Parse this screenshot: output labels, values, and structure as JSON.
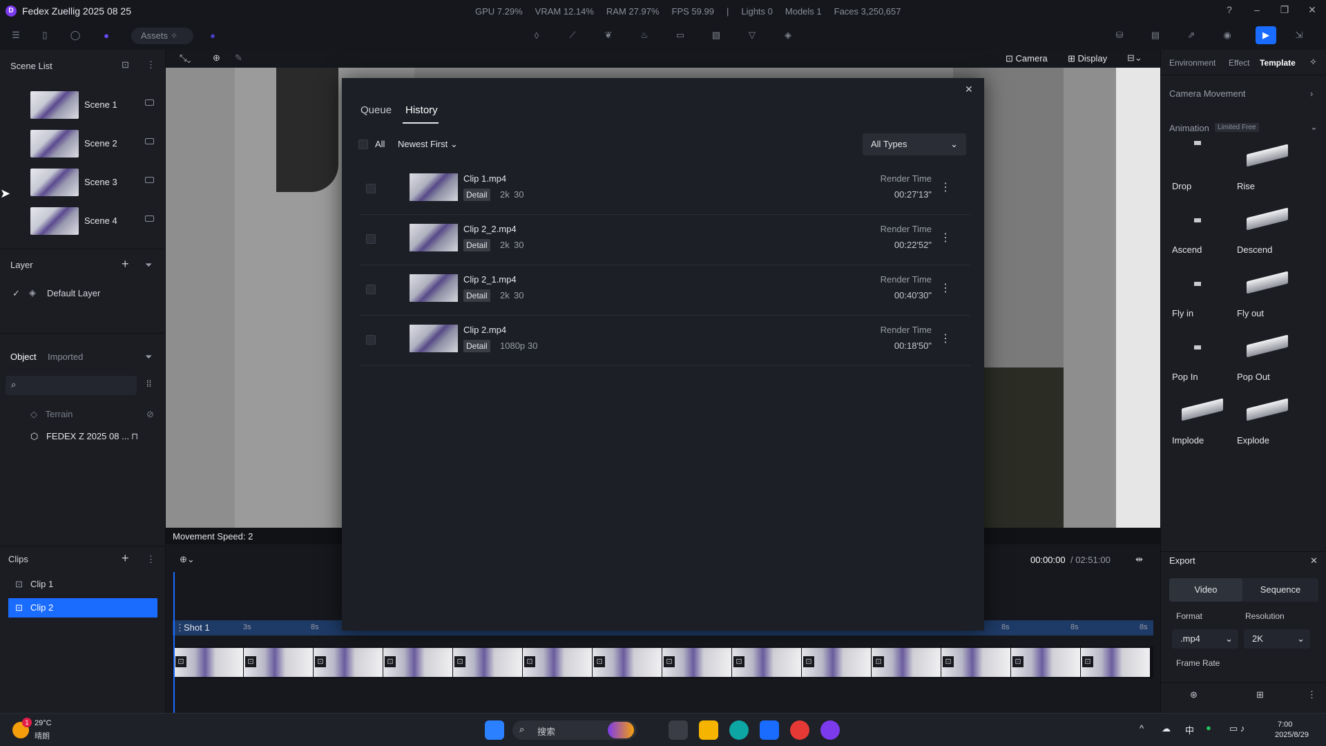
{
  "window": {
    "title": "Fedex Zuellig 2025 08 25",
    "stats": [
      "GPU 7.29%",
      "VRAM 12.14%",
      "RAM 27.97%",
      "FPS 59.99",
      "|",
      "Lights 0",
      "Models 1",
      "Faces 3,250,657"
    ]
  },
  "toolbar": {
    "assets_label": "Assets"
  },
  "left": {
    "scene_list_title": "Scene List",
    "scenes": [
      "Scene 1",
      "Scene 2",
      "Scene 3",
      "Scene 4"
    ],
    "layer_title": "Layer",
    "default_layer": "Default Layer",
    "tabs": [
      "Object",
      "Imported"
    ],
    "objects": [
      "Terrain",
      "FEDEX Z 2025 08 ..."
    ],
    "clips_title": "Clips",
    "clips": [
      "Clip 1",
      "Clip 2"
    ]
  },
  "viewport": {
    "camera_label": "Camera",
    "display_label": "Display",
    "movement_speed": "Movement Speed: 2"
  },
  "timeline": {
    "current_time": "00:00:00",
    "total_time": "/ 02:51:00",
    "shot_label": "Shot 1",
    "tick_labels": [
      "3s",
      "8s",
      "8s",
      "8s",
      "8s"
    ]
  },
  "right": {
    "tabs": [
      "Environment",
      "Effect",
      "Template"
    ],
    "camera_movement": "Camera Movement",
    "animation": "Animation",
    "animation_badge": "Limited Free",
    "animations": [
      "Drop",
      "Rise",
      "Ascend",
      "Descend",
      "Fly in",
      "Fly out",
      "Pop In",
      "Pop Out",
      "Implode",
      "Explode"
    ],
    "export_title": "Export",
    "export_tabs": [
      "Video",
      "Sequence"
    ],
    "format_label": "Format",
    "format_value": ".mp4",
    "resolution_label": "Resolution",
    "resolution_value": "2K",
    "frame_rate_label": "Frame Rate"
  },
  "modal": {
    "tabs": [
      "Queue",
      "History"
    ],
    "active_tab": "History",
    "select_all": "All",
    "sort": "Newest First",
    "type_filter": "All Types",
    "items": [
      {
        "name": "Clip 1.mp4",
        "tag": "Detail",
        "res": "2k",
        "fps": "30",
        "time_label": "Render Time",
        "time": "00:27'13\""
      },
      {
        "name": "Clip 2_2.mp4",
        "tag": "Detail",
        "res": "2k",
        "fps": "30",
        "time_label": "Render Time",
        "time": "00:22'52\""
      },
      {
        "name": "Clip 2_1.mp4",
        "tag": "Detail",
        "res": "2k",
        "fps": "30",
        "time_label": "Render Time",
        "time": "00:40'30\""
      },
      {
        "name": "Clip 2.mp4",
        "tag": "Detail",
        "res": "1080p",
        "fps": "30",
        "time_label": "Render Time",
        "time": "00:18'50\""
      }
    ]
  },
  "taskbar": {
    "weather_temp": "29°C",
    "weather_desc": "晴朗",
    "search_placeholder": "搜索",
    "ime": "中",
    "time": "7:00",
    "date": "2025/8/29",
    "weather_badge": "1"
  }
}
